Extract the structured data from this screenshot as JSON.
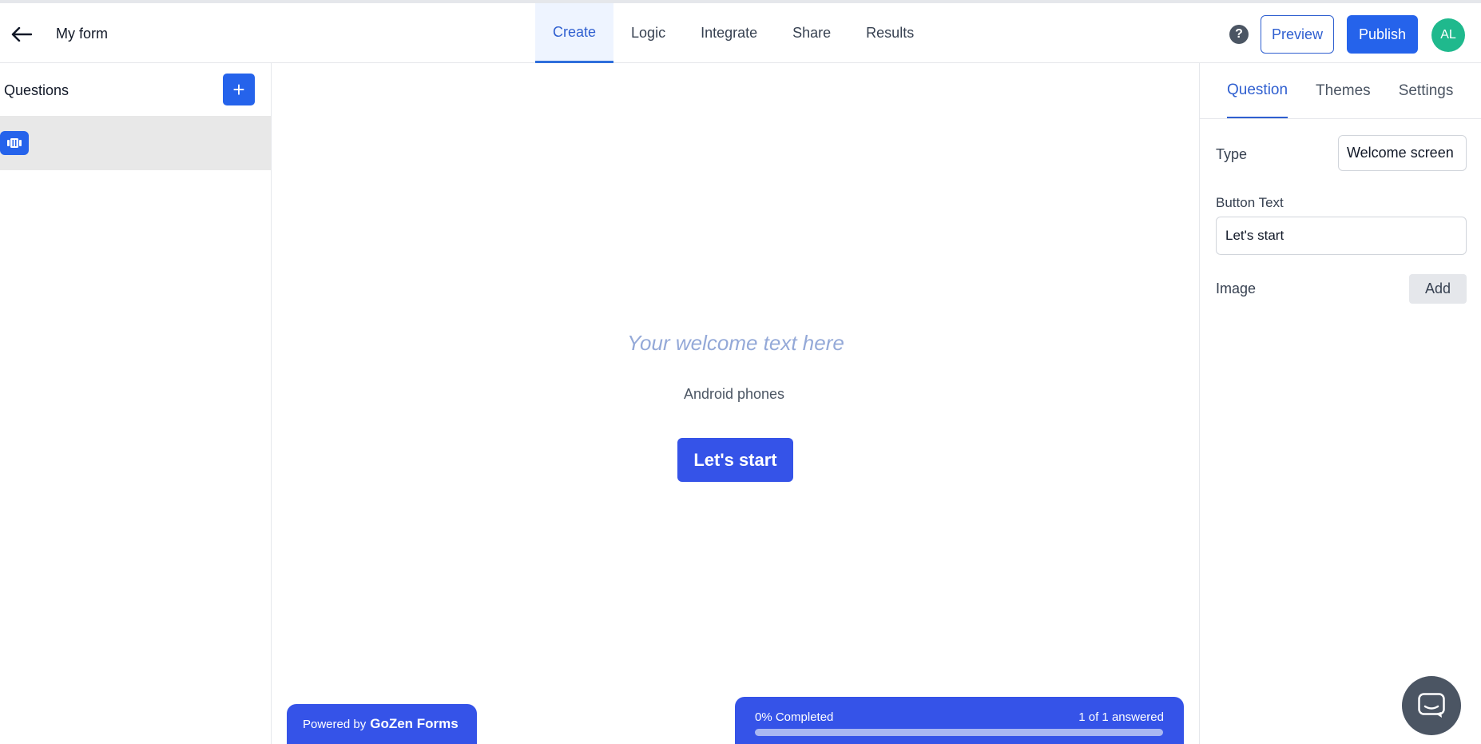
{
  "header": {
    "form_title": "My form",
    "tabs": [
      {
        "label": "Create",
        "active": true
      },
      {
        "label": "Logic",
        "active": false
      },
      {
        "label": "Integrate",
        "active": false
      },
      {
        "label": "Share",
        "active": false
      },
      {
        "label": "Results",
        "active": false
      }
    ],
    "help_glyph": "?",
    "preview_label": "Preview",
    "publish_label": "Publish",
    "avatar_initials": "AL"
  },
  "sidebar": {
    "title": "Questions",
    "add_glyph": "+",
    "items": [
      {
        "icon": "welcome-screen-icon",
        "selected": true
      }
    ]
  },
  "canvas": {
    "welcome_text": "Your welcome text here",
    "description": "Android phones",
    "start_button": "Let's start",
    "powered_by_prefix": "Powered by",
    "powered_by_brand": "GoZen Forms",
    "progress": {
      "label": "0% Completed",
      "answered": "1 of 1 answered",
      "percent": 0
    }
  },
  "right_panel": {
    "tabs": [
      {
        "label": "Question",
        "active": true
      },
      {
        "label": "Themes",
        "active": false
      },
      {
        "label": "Settings",
        "active": false
      }
    ],
    "type_label": "Type",
    "type_value": "Welcome screen",
    "button_text_label": "Button Text",
    "button_text_value": "Let's start",
    "image_label": "Image",
    "image_add_label": "Add"
  },
  "colors": {
    "primary": "#2563eb",
    "canvas_accent": "#3553e8",
    "avatar": "#1fb98d",
    "active_tab_bg": "#eef4ff"
  }
}
